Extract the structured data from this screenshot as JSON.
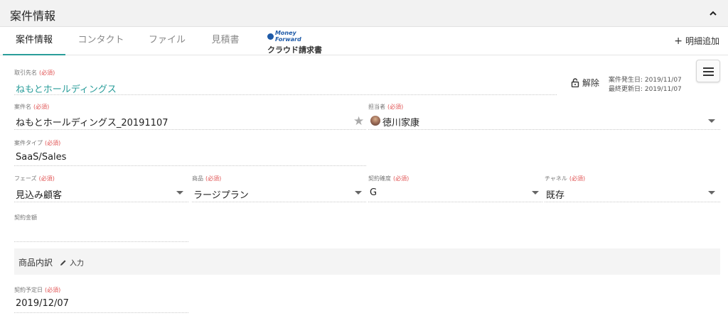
{
  "header": {
    "title": "案件情報"
  },
  "tabs": [
    {
      "label": "案件情報",
      "active": true
    },
    {
      "label": "コンタクト"
    },
    {
      "label": "ファイル"
    },
    {
      "label": "見積書"
    }
  ],
  "mf_tab": {
    "brand": "Money Forward",
    "product": "クラウド請求書"
  },
  "add_detail": {
    "label": "明細追加"
  },
  "required_mark": "(必須)",
  "fields": {
    "company": {
      "label": "取引先名",
      "value": "ねもとホールディングス"
    },
    "deal_name": {
      "label": "案件名",
      "value": "ねもとホールディングス_20191107"
    },
    "owner": {
      "label": "担当者",
      "value": "徳川家康"
    },
    "deal_type": {
      "label": "案件タイプ",
      "value": "SaaS/Sales"
    },
    "phase": {
      "label": "フェーズ",
      "value": "見込み顧客"
    },
    "product": {
      "label": "商品",
      "value": "ラージプラン"
    },
    "probability": {
      "label": "契約確度",
      "value": "G"
    },
    "channel": {
      "label": "チャネル",
      "value": "既存"
    },
    "amount": {
      "label": "契約金額",
      "value": ""
    },
    "contract_date": {
      "label": "契約予定日",
      "value": "2019/12/07"
    }
  },
  "unlock": {
    "label": "解除"
  },
  "dates": {
    "created": "案件発生日: 2019/11/07",
    "updated": "最終更新日: 2019/11/07"
  },
  "section": {
    "title": "商品内訳",
    "edit_label": "入力"
  },
  "colors": {
    "accent": "#2a9d9a",
    "required": "#e05050"
  }
}
